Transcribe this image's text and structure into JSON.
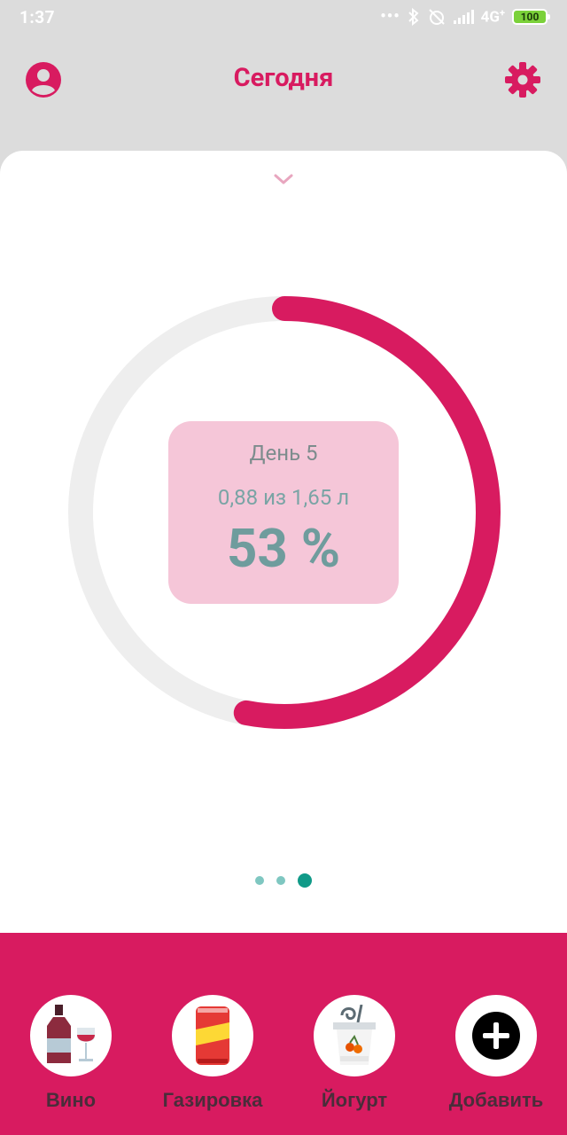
{
  "status_bar": {
    "time": "1:37",
    "network": "4G",
    "battery": "100"
  },
  "header": {
    "title": "Сегодня",
    "profile_icon": "account-circle-icon",
    "settings_icon": "gear-icon"
  },
  "progress": {
    "day_label": "День 5",
    "amount_label": "0,88 из 1,65 л",
    "percent_label": "53 %",
    "fraction": 0.53,
    "track_color": "#eeeeee",
    "fill_color": "#d81b60"
  },
  "pager": {
    "count": 3,
    "active_index": 2
  },
  "drinks": [
    {
      "label": "Вино",
      "icon": "wine-icon"
    },
    {
      "label": "Газировка",
      "icon": "soda-can-icon"
    },
    {
      "label": "Йогурт",
      "icon": "yogurt-icon"
    },
    {
      "label": "Добавить",
      "icon": "plus-icon"
    }
  ],
  "colors": {
    "accent": "#d81b60",
    "header_bg": "#dcdcdc",
    "teal": "#109a88"
  }
}
